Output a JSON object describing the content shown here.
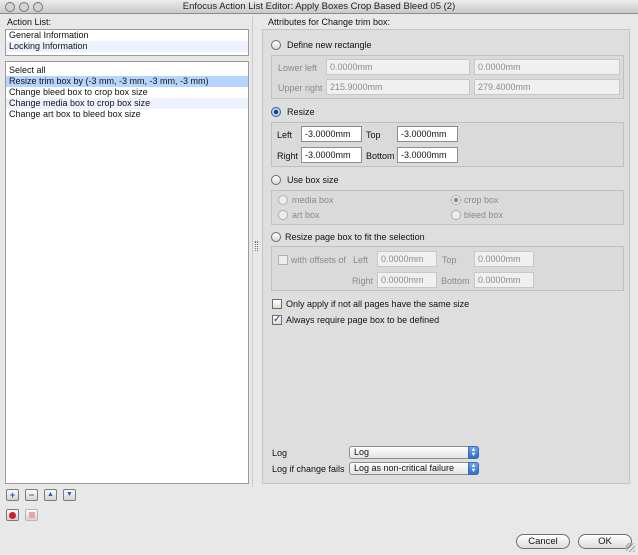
{
  "window": {
    "title": "Enfocus Action List Editor: Apply Boxes Crop Based Bleed 05 (2)"
  },
  "left": {
    "action_list_label": "Action List:",
    "info_items": [
      "General Information",
      "Locking Information"
    ],
    "actions": [
      "Select all",
      "Resize trim box by (-3 mm, -3 mm, -3 mm, -3 mm)",
      "Change bleed box to crop box size",
      "Change media box to crop box size",
      "Change art box to bleed box size"
    ],
    "selected_action_index": 1,
    "list_buttons": {
      "add": "+",
      "remove": "−",
      "up": "▲",
      "down": "▼"
    }
  },
  "right": {
    "heading": "Attributes for Change trim box:",
    "define_new_rectangle": {
      "label": "Define new rectangle",
      "selected": false,
      "lower_left_label": "Lower left",
      "lower_left_x": "0.0000mm",
      "lower_left_y": "0.0000mm",
      "upper_right_label": "Upper right",
      "upper_right_x": "215.9000mm",
      "upper_right_y": "279.4000mm"
    },
    "resize": {
      "label": "Resize",
      "selected": true,
      "left_label": "Left",
      "left_value": "-3.0000mm",
      "top_label": "Top",
      "top_value": "-3.0000mm",
      "right_label": "Right",
      "right_value": "-3.0000mm",
      "bottom_label": "Bottom",
      "bottom_value": "-3.0000mm"
    },
    "use_box_size": {
      "label": "Use box size",
      "selected": false,
      "options": [
        "media box",
        "crop box",
        "art box",
        "bleed box"
      ],
      "selected_option": "crop box"
    },
    "resize_page_box": {
      "label": "Resize page box to fit the selection",
      "selected": false,
      "with_offsets_label": "with offsets of",
      "left_label": "Left",
      "left_value": "0.0000mm",
      "top_label": "Top",
      "top_value": "0.0000mm",
      "right_label": "Right",
      "right_value": "0.0000mm",
      "bottom_label": "Bottom",
      "bottom_value": "0.0000mm"
    },
    "only_apply_label": "Only apply if not all pages have the same size",
    "only_apply_checked": false,
    "always_require_label": "Always require page box to be defined",
    "always_require_checked": true,
    "log_label": "Log",
    "log_value": "Log",
    "log_fail_label": "Log if change fails",
    "log_fail_value": "Log as non-critical failure"
  },
  "footer": {
    "cancel_label": "Cancel",
    "ok_label": "OK"
  },
  "colors": {
    "selection": "#b5d5ff",
    "alt_row": "#edf3fe",
    "accent": "#2f6ccc",
    "record": "#d81e1e"
  }
}
